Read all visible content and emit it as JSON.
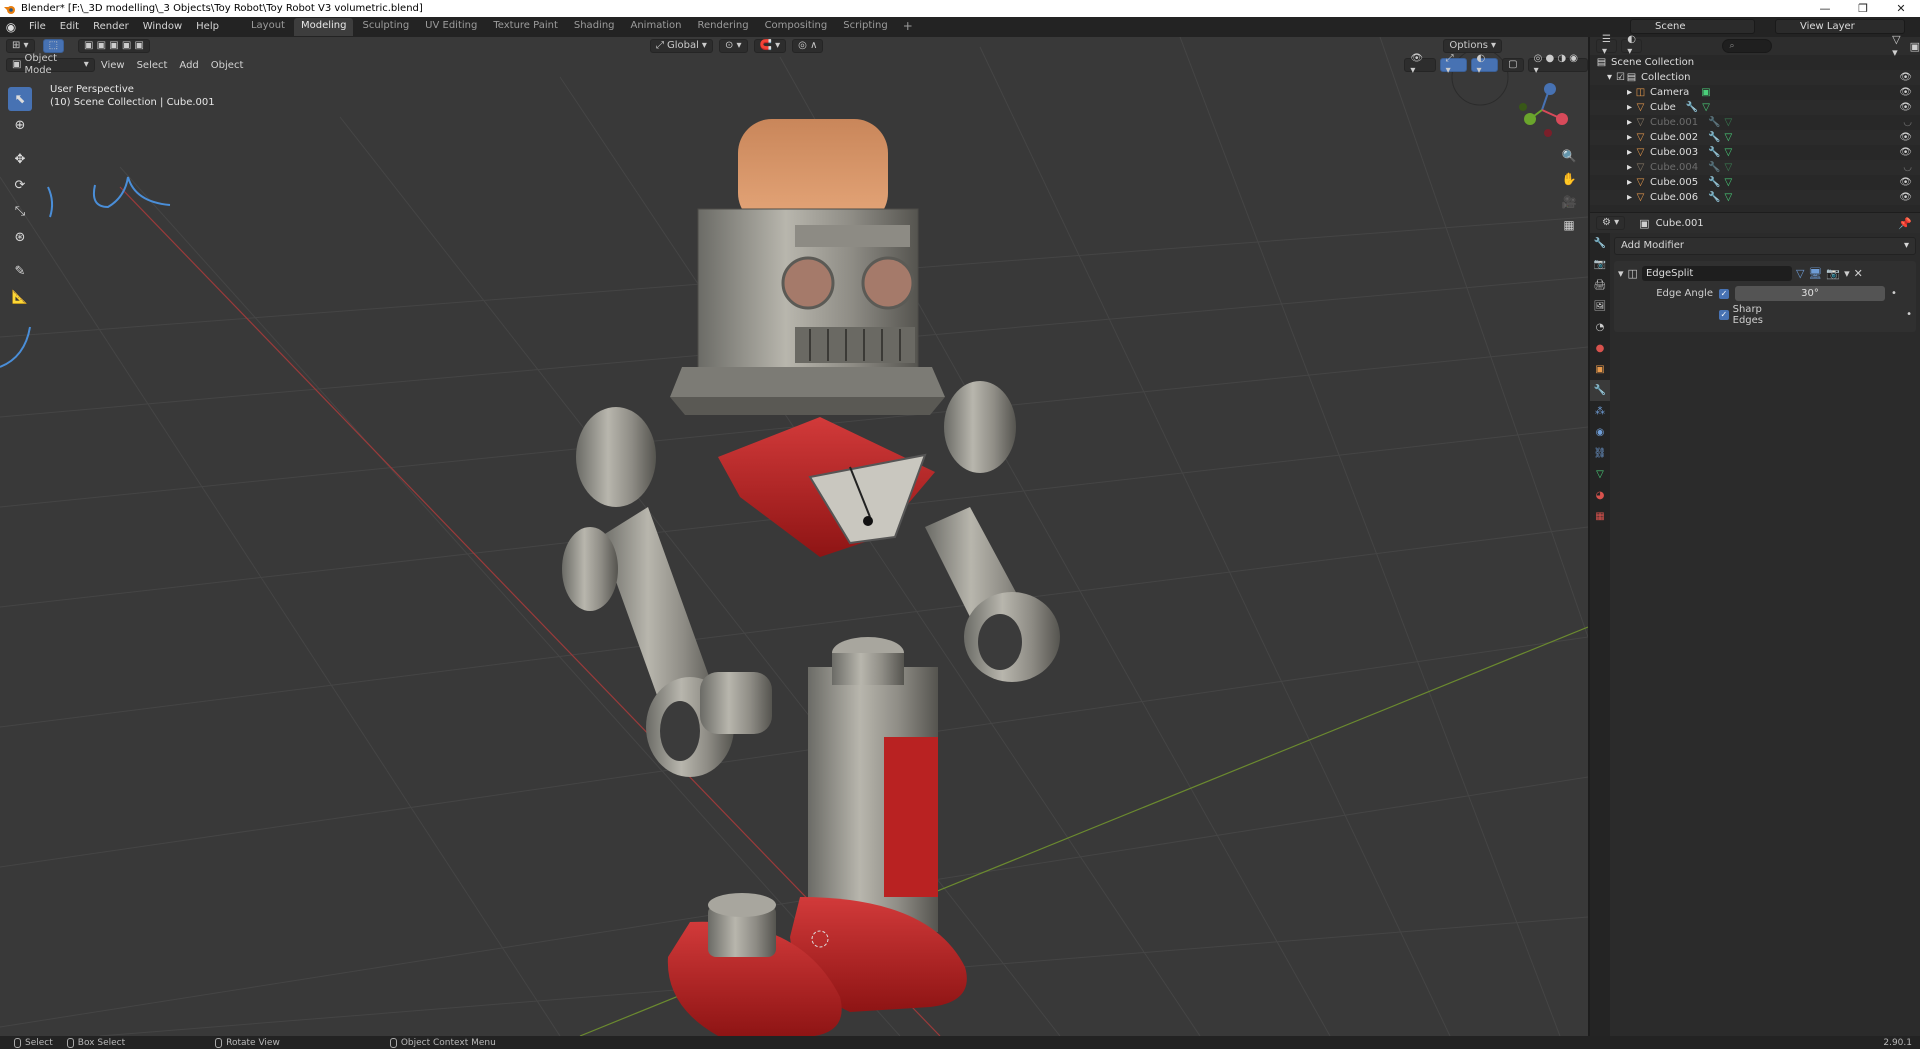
{
  "window": {
    "title": "Blender* [F:\\_3D modelling\\_3 Objects\\Toy Robot\\Toy Robot V3 volumetric.blend]",
    "controls": [
      "—",
      "❐",
      "✕"
    ]
  },
  "menu": [
    "File",
    "Edit",
    "Render",
    "Window",
    "Help"
  ],
  "workspaces": {
    "active": "Modeling",
    "tabs": [
      "Layout",
      "Modeling",
      "Sculpting",
      "UV Editing",
      "Texture Paint",
      "Shading",
      "Animation",
      "Rendering",
      "Compositing",
      "Scripting"
    ],
    "add": "+"
  },
  "scene": {
    "name": "Scene",
    "view_layer": "View Layer"
  },
  "viewport": {
    "mode": "Object Mode",
    "menus": [
      "View",
      "Select",
      "Add",
      "Object"
    ],
    "transform_orientation": "Global",
    "options_label": "Options",
    "info_line1": "User Perspective",
    "info_line2": "(10) Scene Collection | Cube.001"
  },
  "outliner": {
    "root": "Scene Collection",
    "collection": "Collection",
    "items": [
      {
        "name": "Camera",
        "type": "camera",
        "dim": false
      },
      {
        "name": "Cube",
        "type": "mesh",
        "dim": false
      },
      {
        "name": "Cube.001",
        "type": "mesh",
        "dim": true
      },
      {
        "name": "Cube.002",
        "type": "mesh",
        "dim": false
      },
      {
        "name": "Cube.003",
        "type": "mesh",
        "dim": false
      },
      {
        "name": "Cube.004",
        "type": "mesh",
        "dim": true
      },
      {
        "name": "Cube.005",
        "type": "mesh",
        "dim": false
      },
      {
        "name": "Cube.006",
        "type": "mesh",
        "dim": false
      }
    ]
  },
  "properties": {
    "object_name": "Cube.001",
    "add_modifier": "Add Modifier",
    "modifier": {
      "name": "EdgeSplit",
      "edge_angle_label": "Edge Angle",
      "edge_angle_value": "30°",
      "sharp_edges_label": "Sharp Edges"
    }
  },
  "statusbar": {
    "items": [
      "Select",
      "Box Select",
      "Rotate View",
      "Object Context Menu"
    ],
    "version": "2.90.1"
  }
}
